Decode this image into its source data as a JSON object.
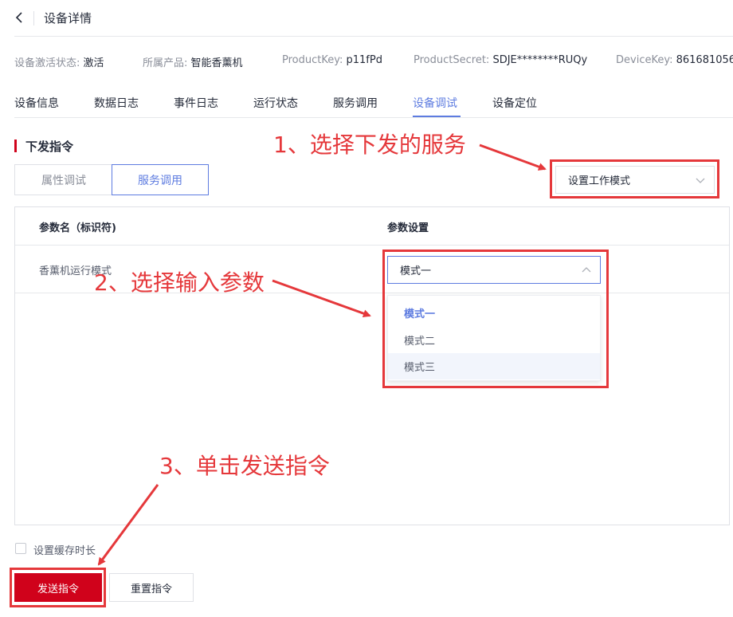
{
  "header": {
    "title": "设备详情",
    "back_icon": "chevron-left-icon"
  },
  "info": {
    "activation_key": "设备激活状态:",
    "activation_val": "激活",
    "product_key_label": "所属产品:",
    "product_val": "智能香薰机",
    "productkey_label": "ProductKey:",
    "productkey_val": "p11fPd",
    "secret_label": "ProductSecret:",
    "secret_val": "SDJE********RUQy",
    "devicekey_label": "DeviceKey:",
    "devicekey_val": "861681056"
  },
  "tabs": [
    {
      "label": "设备信息"
    },
    {
      "label": "数据日志"
    },
    {
      "label": "事件日志"
    },
    {
      "label": "运行状态"
    },
    {
      "label": "服务调用"
    },
    {
      "label": "设备调试",
      "active": true
    },
    {
      "label": "设备定位"
    }
  ],
  "section": {
    "title": "下发指令",
    "seg_property": "属性调试",
    "seg_service": "服务调用",
    "service_select_value": "设置工作模式"
  },
  "table": {
    "col_name": "参数名（标识符)",
    "col_setting": "参数设置",
    "row_label": "香薰机运行模式",
    "param_value": "模式一",
    "options": [
      {
        "label": "模式一",
        "selected": true
      },
      {
        "label": "模式二"
      },
      {
        "label": "模式三",
        "hover": true
      }
    ]
  },
  "footer": {
    "cache_label": "设置缓存时长",
    "send_label": "发送指令",
    "reset_label": "重置指令"
  },
  "annotations": {
    "step1": "1、选择下发的服务",
    "step2": "2、选择输入参数",
    "step3": "3、单击发送指令"
  },
  "colors": {
    "accent": "#5e7ce0",
    "brand_red": "#d0021b",
    "annotation_red": "#e5383b"
  }
}
